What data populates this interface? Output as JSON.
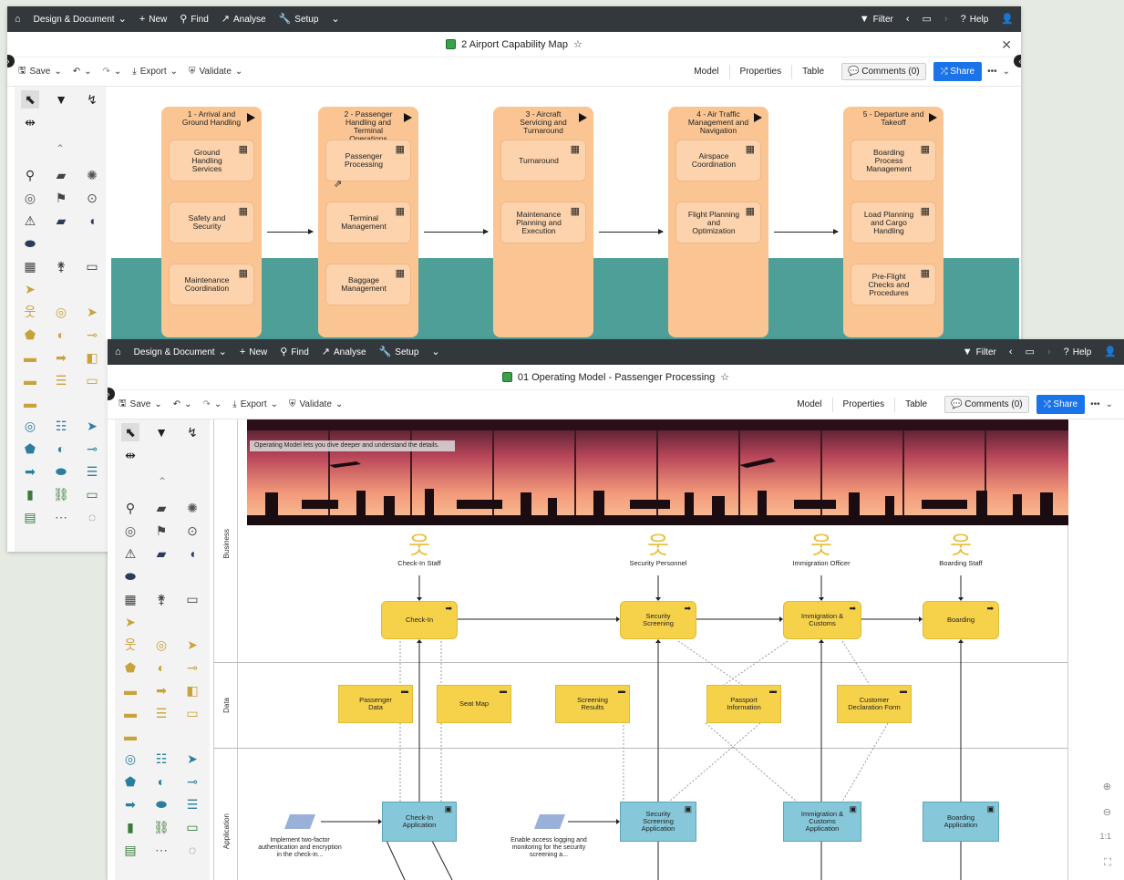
{
  "colors": {
    "topbar": "#33383d",
    "capability_col": "#fbc593",
    "capability": "#fcd3ac",
    "teal": "#4e9f98",
    "process": "#f6d24b",
    "app": "#86c7d9",
    "share": "#1a73e8"
  },
  "window1": {
    "menu": {
      "design": "Design & Document",
      "new": "New",
      "find": "Find",
      "analyse": "Analyse",
      "setup": "Setup",
      "filter": "Filter",
      "help": "Help"
    },
    "title": "2 Airport Capability Map",
    "toolbar": {
      "save": "Save",
      "export": "Export",
      "validate": "Validate"
    },
    "tabs": [
      "Model",
      "Properties",
      "Table"
    ],
    "comments": "Comments (0)",
    "share": "Share",
    "columns": [
      {
        "title": "1 - Arrival and Ground Handling",
        "items": [
          "Ground Handling Services",
          "Safety and Security",
          "Maintenance Coordination"
        ]
      },
      {
        "title": "2 - Passenger Handling and Terminal Operations",
        "items": [
          "Passenger Processing",
          "Terminal Management",
          "Baggage Management"
        ]
      },
      {
        "title": "3 - Aircraft Servicing and Turnaround",
        "items": [
          "Turnaround",
          "Maintenance Planning and Execution"
        ]
      },
      {
        "title": "4 - Air Traffic Management and Navigation",
        "items": [
          "Airspace Coordination",
          "Flight Planning and Optimization"
        ]
      },
      {
        "title": "5 - Departure and Takeoff",
        "items": [
          "Boarding Process Management",
          "Load Planning and Cargo Handling",
          "Pre-Flight Checks and Procedures"
        ]
      }
    ]
  },
  "window2": {
    "menu": {
      "design": "Design & Document",
      "new": "New",
      "find": "Find",
      "analyse": "Analyse",
      "setup": "Setup",
      "filter": "Filter",
      "help": "Help"
    },
    "title": "01 Operating Model - Passenger Processing",
    "toolbar": {
      "save": "Save",
      "export": "Export",
      "validate": "Validate"
    },
    "tabs": [
      "Model",
      "Properties",
      "Table"
    ],
    "comments": "Comments (0)",
    "share": "Share",
    "banner_note": "Operating Model lets you dive deeper and understand the details.",
    "lanes": [
      "Business",
      "Data",
      "Application"
    ],
    "actors": [
      "Check-In Staff",
      "Security Personnel",
      "Immigration Officer",
      "Boarding Staff"
    ],
    "processes": [
      "Check-In",
      "Security Screening",
      "Immigration & Customs",
      "Boarding"
    ],
    "data_objects": [
      "Passenger Data",
      "Seat Map",
      "Screening Results",
      "Passport Information",
      "Customer Declaration Form"
    ],
    "apps": [
      "Check-In Application",
      "Security Screening Application",
      "Immigration & Customs Application",
      "Boarding Application"
    ],
    "notes": [
      "Implement two-factor authentication and encryption in the check-in...",
      "Enable access logging and monitoring for the security screening a..."
    ]
  }
}
